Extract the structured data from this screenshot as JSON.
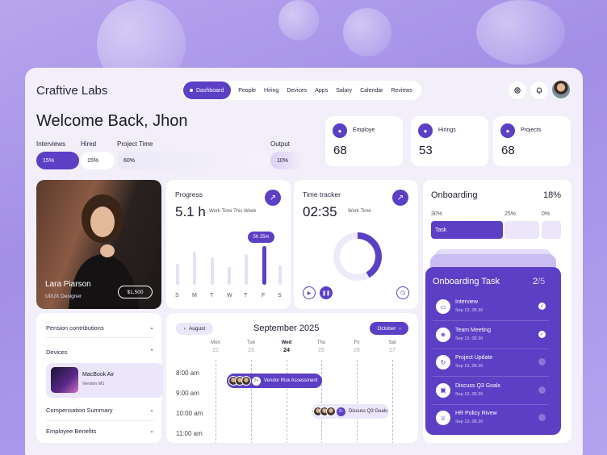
{
  "app": {
    "title": "Craftive Labs"
  },
  "nav": {
    "active": "Dashboard",
    "items": [
      "People",
      "Hiring",
      "Devices",
      "Apps",
      "Salary",
      "Calendar",
      "Reviews"
    ]
  },
  "header": {
    "welcome": "Welcome Back, Jhon"
  },
  "stats": {
    "interviews_label": "Interviews",
    "interviews_value": "15%",
    "hired_label": "Hired",
    "hired_value": "15%",
    "project_time_label": "Project Time",
    "project_time_value": "60%",
    "output_label": "Output",
    "output_value": "10%"
  },
  "summary_cards": [
    {
      "label": "Employe",
      "value": "68",
      "icon": "users-icon"
    },
    {
      "label": "Hirings",
      "value": "53",
      "icon": "user-icon"
    },
    {
      "label": "Projects",
      "value": "68",
      "icon": "user-icon"
    }
  ],
  "profile": {
    "name": "Lara Piarson",
    "role": "UI/UX Designer",
    "salary": "$1,500"
  },
  "progress": {
    "title": "Progress",
    "hours": "5.1 h",
    "caption": "Work Time This Week",
    "tooltip": "5h 25m",
    "days": [
      "S",
      "M",
      "T",
      "W",
      "T",
      "F",
      "S"
    ],
    "values": [
      0.55,
      0.85,
      0.7,
      0.45,
      0.8,
      1.0,
      0.5
    ],
    "active_index": 5
  },
  "time_tracker": {
    "title": "Time tracker",
    "time": "02:35",
    "caption": "Work Time",
    "ring_fraction": 0.42
  },
  "onboarding": {
    "title": "Onboarding",
    "percent": "18%",
    "segments": [
      "30%",
      "25%",
      "0%"
    ],
    "task_label": "Task"
  },
  "onboarding_task": {
    "title": "Onboarding Task",
    "done": "2",
    "total": "/5",
    "tasks": [
      {
        "name": "Interview",
        "date": "Sep 13, 08.30",
        "done": true,
        "icon": "monitor-icon"
      },
      {
        "name": "Team Meeting",
        "date": "Sep 13, 08.30",
        "done": true,
        "icon": "cube-icon"
      },
      {
        "name": "Project Update",
        "date": "Sep 13, 08.30",
        "done": false,
        "icon": "refresh-icon"
      },
      {
        "name": "Discuss Q3 Goals",
        "date": "Sep 13, 08.30",
        "done": false,
        "icon": "briefcase-icon"
      },
      {
        "name": "HR Policy Rivew",
        "date": "Sep 13, 08.30",
        "done": false,
        "icon": "trophy-icon"
      }
    ]
  },
  "sidebar": {
    "pension": "Pension contributions",
    "devices": "Devices",
    "device_name": "MacBook Air",
    "device_version": "Version M1",
    "compensation": "Compensation Summary",
    "benefits": "Employee Benefits"
  },
  "calendar": {
    "prev": "August",
    "title": "September 2025",
    "next": "October",
    "days": [
      {
        "name": "Mon",
        "num": "22"
      },
      {
        "name": "Tue",
        "num": "23"
      },
      {
        "name": "Wed",
        "num": "24"
      },
      {
        "name": "Thu",
        "num": "25"
      },
      {
        "name": "Fri",
        "num": "26"
      },
      {
        "name": "Sat",
        "num": "27"
      }
    ],
    "times": [
      "8:00 am",
      "9:00 am",
      "10:00 am",
      "11:00 am"
    ],
    "events": [
      {
        "title": "Vendor Risk Assessment",
        "extra": "2+"
      },
      {
        "title": "Discuss Q3 Goals",
        "extra": "2+"
      }
    ]
  },
  "colors": {
    "accent": "#5b3fc4",
    "bg": "#f2effb"
  }
}
